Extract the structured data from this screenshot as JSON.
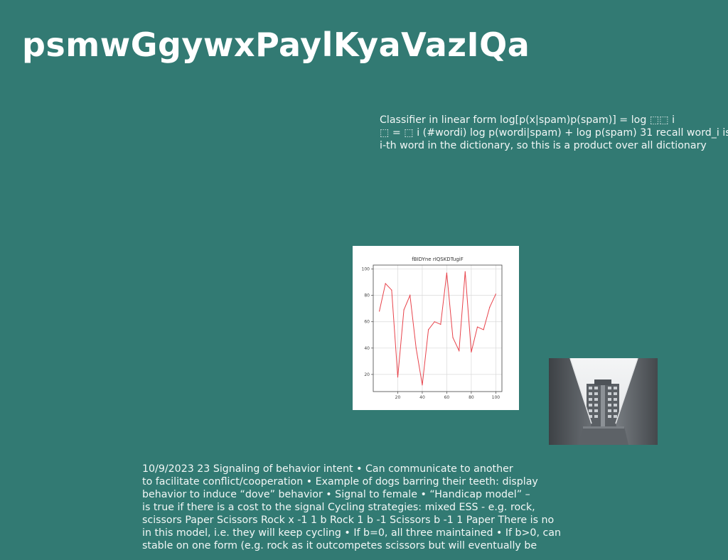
{
  "slide": {
    "title": "psmwGgywxPaylKyaVazIQa"
  },
  "top_text": {
    "lines": [
      "Classifier in linear form log[p(x|spam)p(spam)] = log ⬚⬚ i",
      "⬚ = ⬚ i (#wordi) log p(wordi|spam) + log p(spam) 31 recall word_i is",
      "i-th word in the dictionary, so this is a product over all dictionary"
    ]
  },
  "bottom_text": {
    "lines": [
      "10/9/2023 23 Signaling of behavior intent • Can communicate to another",
      "to facilitate conflict/cooperation • Example of dogs barring their teeth: display",
      "behavior to induce “dove” behavior • Signal to female • “Handicap model” –",
      "is true if there is a cost to the signal Cycling strategies: mixed ESS - e.g. rock,",
      "scissors Paper Scissors Rock x -1 1 b Rock 1 b -1 Scissors b -1 1 Paper There is no",
      "in this model, i.e. they will keep cycling • If b=0, all three maintained • If b>0, can",
      "stable on one form (e.g. rock as it outcompetes scissors but will eventually be"
    ]
  },
  "colors": {
    "background": "#327a73",
    "text": "#ffffff",
    "chart_line": "#e8434b"
  },
  "chart_data": {
    "type": "line",
    "title": "fBIDYne rIQSKDTugiF",
    "xlabel": "",
    "ylabel": "",
    "x": [
      5,
      10,
      15,
      20,
      25,
      30,
      35,
      40,
      45,
      50,
      55,
      60,
      65,
      70,
      75,
      80,
      85,
      90,
      95,
      100
    ],
    "values": [
      68,
      89,
      84,
      18,
      69,
      80,
      40,
      12,
      54,
      60,
      58,
      97,
      48,
      38,
      98,
      37,
      56,
      54,
      71,
      81
    ],
    "xticks": [
      20,
      40,
      60,
      80,
      100
    ],
    "yticks": [
      20,
      40,
      60,
      80,
      100
    ],
    "xlim": [
      0,
      105
    ],
    "ylim": [
      7,
      103
    ],
    "grid": true,
    "legend": "none"
  },
  "photo": {
    "subject": "building-between-walls"
  }
}
